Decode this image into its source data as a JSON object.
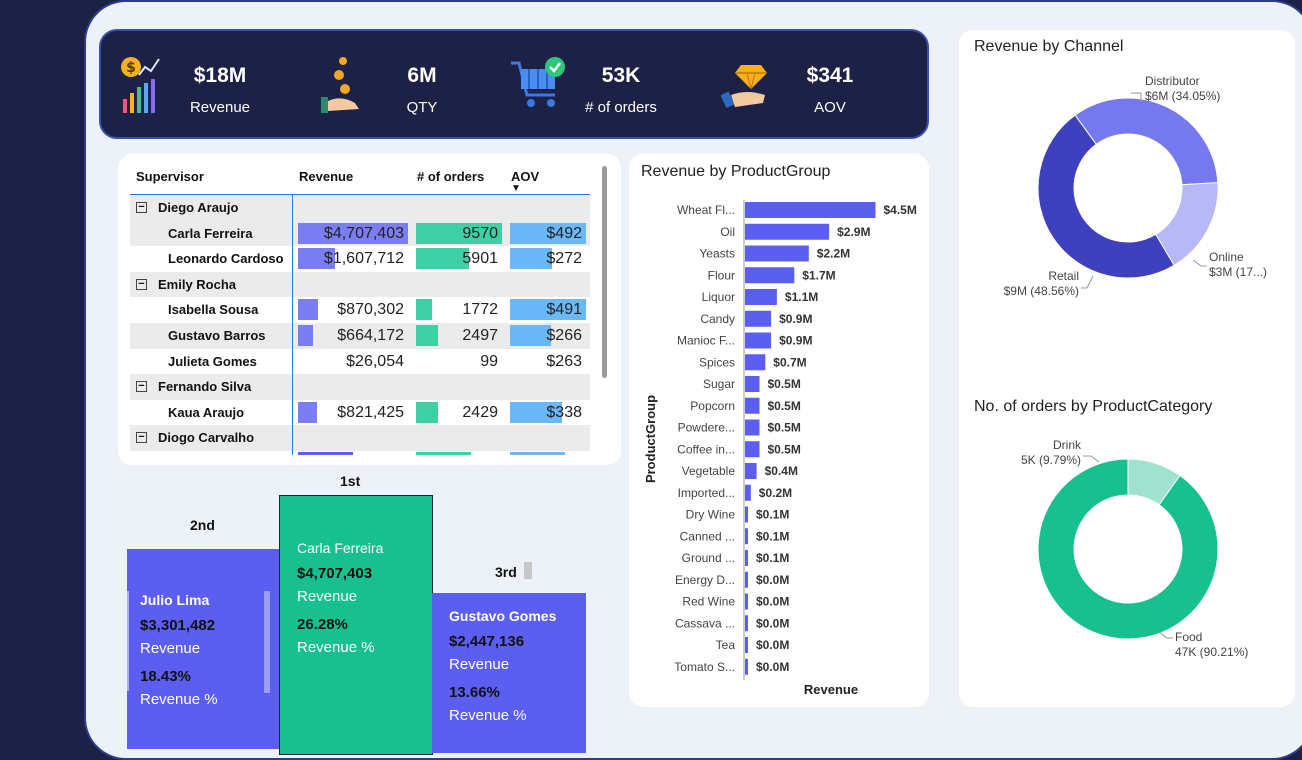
{
  "kpis": [
    {
      "value": "$18M",
      "label": "Revenue",
      "icon": "revenue-chart-icon"
    },
    {
      "value": "6M",
      "label": "QTY",
      "icon": "coin-hand-icon"
    },
    {
      "value": "53K",
      "label": "# of orders",
      "icon": "cart-check-icon"
    },
    {
      "value": "$341",
      "label": "AOV",
      "icon": "diamond-hand-icon"
    }
  ],
  "table": {
    "headers": [
      "Supervisor",
      "Revenue",
      "# of orders",
      "AOV"
    ],
    "sort_indicator": "▼",
    "rows": [
      {
        "type": "group",
        "name": "Diego Araujo",
        "toggle": "−"
      },
      {
        "type": "child",
        "name": "Carla Ferreira",
        "revenue": "$4,707,403",
        "orders": "9570",
        "aov": "$492",
        "rev_frac": 1.0,
        "ord_frac": 1.0,
        "aov_frac": 1.0
      },
      {
        "type": "child",
        "name": "Leonardo Cardoso",
        "revenue": "$1,607,712",
        "orders": "5901",
        "aov": "$272",
        "rev_frac": 0.34,
        "ord_frac": 0.62,
        "aov_frac": 0.55
      },
      {
        "type": "group",
        "name": "Emily Rocha",
        "toggle": "−"
      },
      {
        "type": "child",
        "name": "Isabella Sousa",
        "revenue": "$870,302",
        "orders": "1772",
        "aov": "$491",
        "rev_frac": 0.18,
        "ord_frac": 0.19,
        "aov_frac": 1.0
      },
      {
        "type": "child",
        "name": "Gustavo Barros",
        "revenue": "$664,172",
        "orders": "2497",
        "aov": "$266",
        "rev_frac": 0.14,
        "ord_frac": 0.26,
        "aov_frac": 0.54
      },
      {
        "type": "child",
        "name": "Julieta Gomes",
        "revenue": "$26,054",
        "orders": "99",
        "aov": "$263",
        "rev_frac": 0.0,
        "ord_frac": 0.0,
        "aov_frac": 0.0
      },
      {
        "type": "group",
        "name": "Fernando Silva",
        "toggle": "−"
      },
      {
        "type": "child",
        "name": "Kaua Araujo",
        "revenue": "$821,425",
        "orders": "2429",
        "aov": "$338",
        "rev_frac": 0.17,
        "ord_frac": 0.25,
        "aov_frac": 0.69
      },
      {
        "type": "group",
        "name": "Diogo Carvalho",
        "toggle": "−"
      }
    ]
  },
  "product_group": {
    "title": "Revenue by ProductGroup",
    "ylabel": "ProductGroup",
    "xlabel": "Revenue"
  },
  "channel": {
    "title": "Revenue by Channel",
    "labels": [
      {
        "line1": "Distributor",
        "line2": "$6M (34.05%)"
      },
      {
        "line1": "Online",
        "line2": "$3M (17...)"
      },
      {
        "line1": "Retail",
        "line2": "$9M (48.56%)"
      }
    ]
  },
  "category": {
    "title": "No. of orders by ProductCategory",
    "labels": [
      {
        "line1": "Drink",
        "line2": "5K (9.79%)"
      },
      {
        "line1": "Food",
        "line2": "47K (90.21%)"
      }
    ]
  },
  "podium": {
    "first": {
      "rank": "1st",
      "name": "Carla Ferreira",
      "revenue": "$4,707,403",
      "revenue_label": "Revenue",
      "pct": "26.28%",
      "pct_label": "Revenue %"
    },
    "second": {
      "rank": "2nd",
      "name": "Julio Lima",
      "revenue": "$3,301,482",
      "revenue_label": "Revenue",
      "pct": "18.43%",
      "pct_label": "Revenue %"
    },
    "third": {
      "rank": "3rd",
      "name": "Gustavo Gomes",
      "revenue": "$2,447,136",
      "revenue_label": "Revenue",
      "pct": "13.66%",
      "pct_label": "Revenue %"
    }
  },
  "colors": {
    "primary": "#5b5ef0",
    "teal": "#17c08e",
    "light_blue": "#6ab8f7",
    "navy": "#1c2145"
  },
  "chart_data": [
    {
      "type": "bar",
      "orientation": "horizontal",
      "title": "Revenue by ProductGroup",
      "xlabel": "Revenue",
      "ylabel": "ProductGroup",
      "categories": [
        "Wheat Fl...",
        "Oil",
        "Yeasts",
        "Flour",
        "Liquor",
        "Candy",
        "Manioc F...",
        "Spices",
        "Sugar",
        "Popcorn",
        "Powdere...",
        "Coffee in...",
        "Vegetable",
        "Imported...",
        "Dry Wine",
        "Canned ...",
        "Ground ...",
        "Energy D...",
        "Red Wine",
        "Cassava ...",
        "Tea",
        "Tomato S..."
      ],
      "values": [
        4.5,
        2.9,
        2.2,
        1.7,
        1.1,
        0.9,
        0.9,
        0.7,
        0.5,
        0.5,
        0.5,
        0.5,
        0.4,
        0.2,
        0.1,
        0.1,
        0.1,
        0.0,
        0.0,
        0.0,
        0.0,
        0.0
      ],
      "data_labels": [
        "$4.5M",
        "$2.9M",
        "$2.2M",
        "$1.7M",
        "$1.1M",
        "$0.9M",
        "$0.9M",
        "$0.7M",
        "$0.5M",
        "$0.5M",
        "$0.5M",
        "$0.5M",
        "$0.4M",
        "$0.2M",
        "$0.1M",
        "$0.1M",
        "$0.1M",
        "$0.0M",
        "$0.0M",
        "$0.0M",
        "$0.0M",
        "$0.0M"
      ]
    },
    {
      "type": "pie",
      "style": "donut",
      "title": "Revenue by Channel",
      "categories": [
        "Distributor",
        "Online",
        "Retail"
      ],
      "values": [
        34.05,
        17.39,
        48.56
      ],
      "colors": [
        "#7678ef",
        "#b6b8f7",
        "#3e40bd"
      ]
    },
    {
      "type": "pie",
      "style": "donut",
      "title": "No. of orders by ProductCategory",
      "categories": [
        "Drink",
        "Food"
      ],
      "values": [
        9.79,
        90.21
      ],
      "colors": [
        "#9fe3cf",
        "#17c08e"
      ]
    }
  ]
}
